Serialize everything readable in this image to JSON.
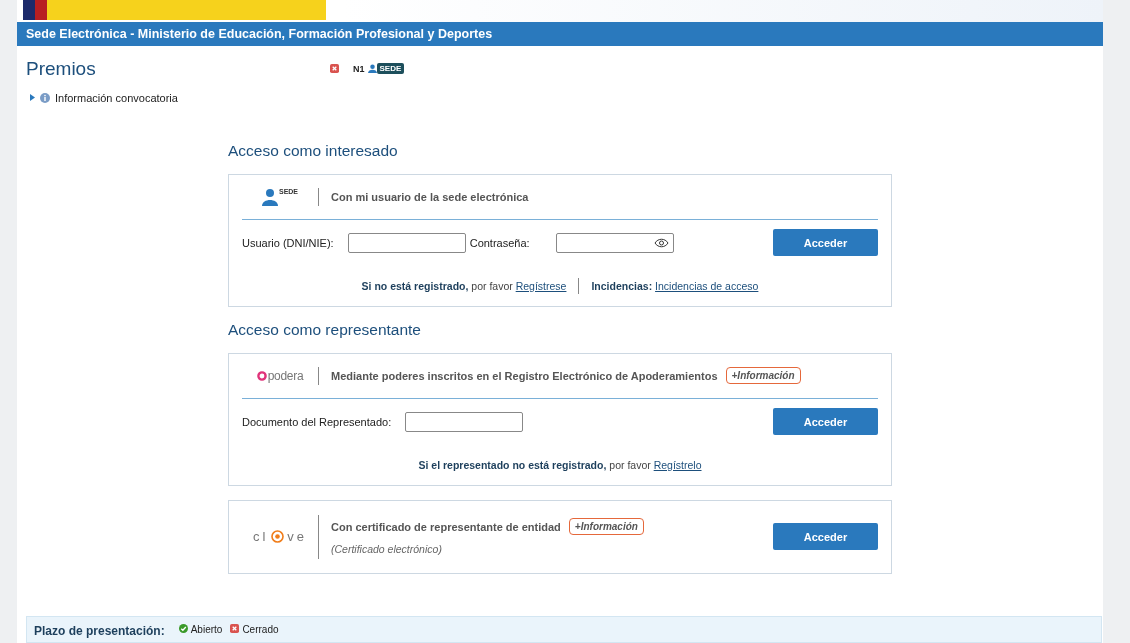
{
  "header_bar": {
    "title": "Sede Electrónica - Ministerio de Educación, Formación Profesional y Deportes"
  },
  "procedure": {
    "title": "Premios",
    "open": false,
    "level": "N1",
    "level_badge": "SEDE"
  },
  "info_toggle": {
    "label": "Información convocatoria",
    "expanded": false
  },
  "sections": [
    {
      "title": "Acceso como interesado",
      "cards": [
        {
          "kind": "sede",
          "logo_badge": "SEDE",
          "heading": "Con mi usuario de la sede electrónica",
          "fields": [
            {
              "label": "Usuario (DNI/NIE):",
              "kind": "text"
            },
            {
              "label": "Contraseña:",
              "kind": "password"
            }
          ],
          "button": "Acceder",
          "links": [
            {
              "prefix": "Si no está registrado,",
              "text": " por favor ",
              "link": "Regístrese"
            },
            {
              "prefix": "Incidencias:",
              "link": "Incidencias de acceso"
            }
          ]
        }
      ]
    },
    {
      "title": "Acceso como representante",
      "cards": [
        {
          "kind": "apodera",
          "logo_text": "podera",
          "heading": "Mediante poderes inscritos en el Registro Electrónico de Apoderamientos",
          "info_tag": "+Información",
          "fields": [
            {
              "label": "Documento del Representado:",
              "kind": "text"
            }
          ],
          "button": "Acceder",
          "links": [
            {
              "prefix": "Si el representado no está registrado,",
              "text": " por favor ",
              "link": "Regístrelo"
            }
          ]
        },
        {
          "kind": "clave",
          "logo_parts": [
            "cl",
            "ve"
          ],
          "heading": "Con certificado de representante de entidad",
          "info_tag": "+Información",
          "subheading": "(Certificado electrónico)",
          "button": "Acceder"
        }
      ]
    }
  ],
  "footer": {
    "label": "Plazo de presentación:",
    "legend": [
      {
        "label": "Abierto",
        "open": true
      },
      {
        "label": "Cerrado",
        "open": false
      }
    ]
  }
}
